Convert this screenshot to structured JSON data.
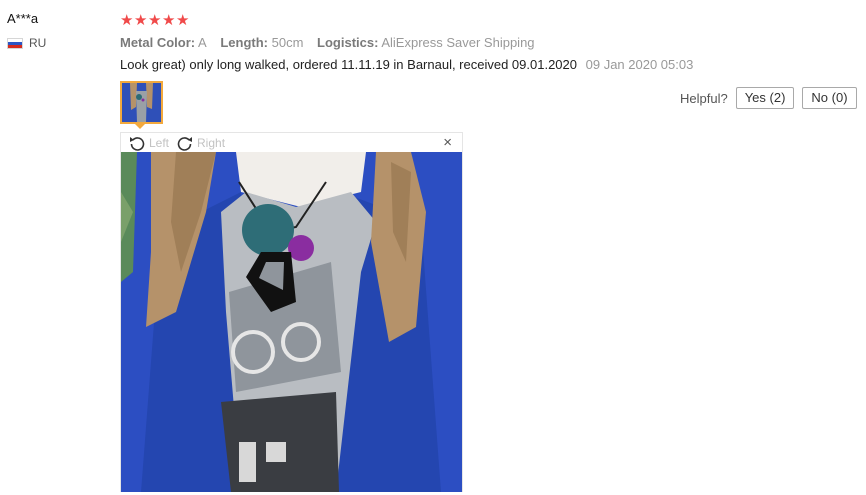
{
  "review": {
    "user_name": "A***a",
    "country_code": "RU",
    "rating": 5,
    "star_glyph": "★",
    "attributes": [
      {
        "key": "Metal Color:",
        "value": "A"
      },
      {
        "key": "Length:",
        "value": "50cm"
      },
      {
        "key": "Logistics:",
        "value": "AliExpress Saver Shipping"
      }
    ],
    "text": "Look great) only long walked, ordered 11.11.19 in Barnaul, received 09.01.2020",
    "date": "09 Jan 2020 05:03"
  },
  "helpful": {
    "label": "Helpful?",
    "yes_label": "Yes (2)",
    "no_label": "No (0)"
  },
  "viewer": {
    "rotate_left_label": "Left",
    "rotate_right_label": "Right",
    "close_glyph": "×"
  },
  "colors": {
    "star": "#f04a4a",
    "thumb_border": "#f3a93d",
    "jacket": "#2c4ec2",
    "hair": "#b5926a"
  }
}
